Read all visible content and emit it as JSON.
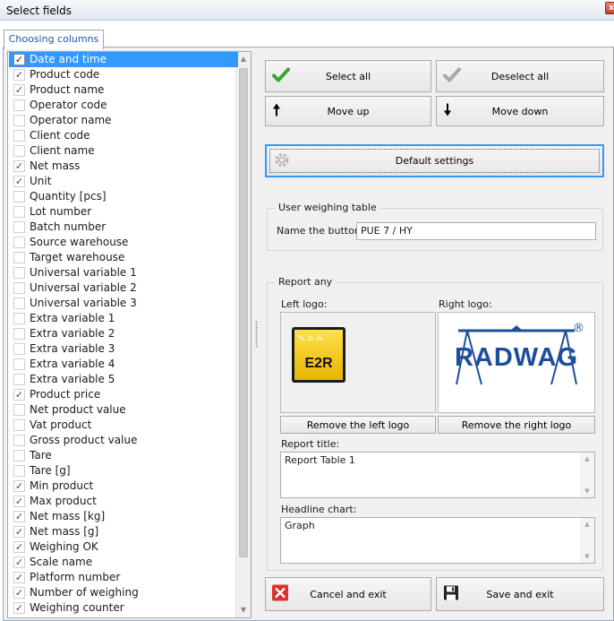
{
  "window": {
    "title": "Select fields",
    "close_glyph": "x"
  },
  "tabs": [
    {
      "label": "Choosing columns"
    }
  ],
  "fields": [
    {
      "label": "Date and time",
      "checked": true,
      "selected": true
    },
    {
      "label": "Product code",
      "checked": true
    },
    {
      "label": "Product name",
      "checked": true
    },
    {
      "label": "Operator code",
      "checked": false
    },
    {
      "label": "Operator name",
      "checked": false
    },
    {
      "label": "Client code",
      "checked": false
    },
    {
      "label": "Client name",
      "checked": false
    },
    {
      "label": "Net mass",
      "checked": true
    },
    {
      "label": "Unit",
      "checked": true
    },
    {
      "label": "Quantity [pcs]",
      "checked": false
    },
    {
      "label": "Lot number",
      "checked": false
    },
    {
      "label": "Batch number",
      "checked": false
    },
    {
      "label": "Source warehouse",
      "checked": false
    },
    {
      "label": "Target warehouse",
      "checked": false
    },
    {
      "label": "Universal variable 1",
      "checked": false
    },
    {
      "label": "Universal variable 2",
      "checked": false
    },
    {
      "label": "Universal variable 3",
      "checked": false
    },
    {
      "label": "Extra variable 1",
      "checked": false
    },
    {
      "label": "Extra variable 2",
      "checked": false
    },
    {
      "label": "Extra variable 3",
      "checked": false
    },
    {
      "label": "Extra variable 4",
      "checked": false
    },
    {
      "label": "Extra variable 5",
      "checked": false
    },
    {
      "label": "Product price",
      "checked": true
    },
    {
      "label": "Net product value",
      "checked": false
    },
    {
      "label": "Vat product",
      "checked": false
    },
    {
      "label": "Gross product value",
      "checked": false
    },
    {
      "label": "Tare",
      "checked": false
    },
    {
      "label": "Tare [g]",
      "checked": false
    },
    {
      "label": "Min product",
      "checked": true
    },
    {
      "label": "Max product",
      "checked": true
    },
    {
      "label": "Net mass [kg]",
      "checked": true
    },
    {
      "label": "Net mass [g]",
      "checked": true
    },
    {
      "label": "Weighing OK",
      "checked": true
    },
    {
      "label": "Scale name",
      "checked": true
    },
    {
      "label": "Platform number",
      "checked": true
    },
    {
      "label": "Number of weighing",
      "checked": true
    },
    {
      "label": "Weighing counter",
      "checked": true
    }
  ],
  "buttons": {
    "select_all": "Select all",
    "deselect_all": "Deselect all",
    "move_up": "Move up",
    "move_down": "Move down",
    "default_settings": "Default settings",
    "remove_left_logo": "Remove the left logo",
    "remove_right_logo": "Remove the right logo",
    "cancel_exit": "Cancel and exit",
    "save_exit": "Save and exit"
  },
  "user_table": {
    "group_title": "User weighing table",
    "name_label": "Name the button:",
    "name_value": "PUE 7 / HY"
  },
  "report": {
    "group_title": "Report any",
    "left_logo_label": "Left logo:",
    "right_logo_label": "Right logo:",
    "left_logo_text": "E2R",
    "left_logo_glyphs": "% ⚖ ⁂",
    "right_logo_text": "RADWAG",
    "right_logo_mark": "®",
    "title_label": "Report title:",
    "title_value": "Report Table 1",
    "headline_label": "Headline chart:",
    "headline_value": "Graph"
  },
  "colors": {
    "selection": "#3399ff",
    "check_green": "#3aa52f",
    "link_blue": "#1f57a6"
  }
}
